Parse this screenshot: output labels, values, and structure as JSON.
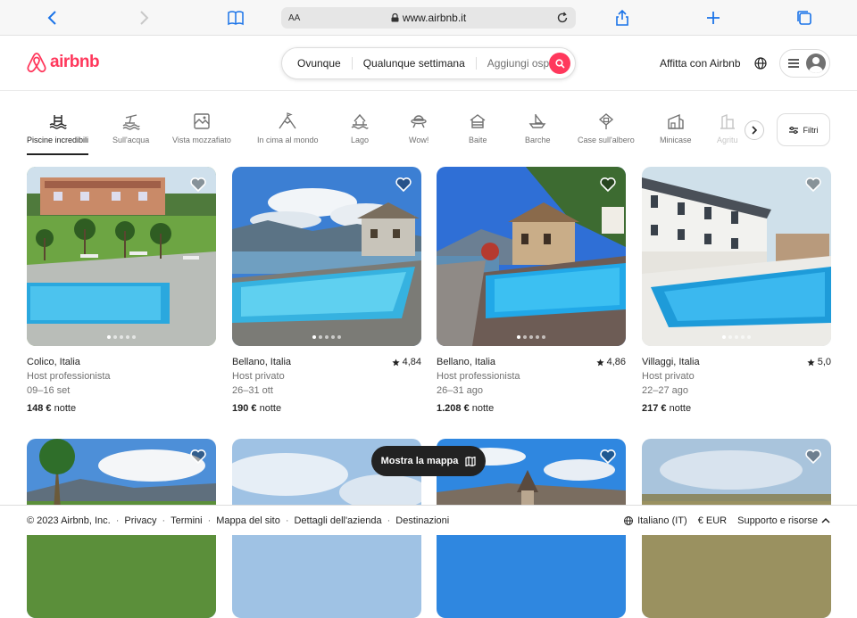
{
  "browser": {
    "aa": "AA",
    "url": "www.airbnb.it"
  },
  "header": {
    "logo": "airbnb",
    "search": {
      "anywhere": "Ovunque",
      "week": "Qualunque settimana",
      "guests": "Aggiungi ospiti"
    },
    "host_link": "Affitta con Airbnb"
  },
  "categories": [
    {
      "label": "Piscine incredibili",
      "icon": "pool-icon"
    },
    {
      "label": "Sull'acqua",
      "icon": "beach-icon"
    },
    {
      "label": "Vista mozzafiato",
      "icon": "view-icon"
    },
    {
      "label": "In cima al mondo",
      "icon": "mountain-icon"
    },
    {
      "label": "Lago",
      "icon": "lake-icon"
    },
    {
      "label": "Wow!",
      "icon": "ufo-icon"
    },
    {
      "label": "Baite",
      "icon": "cabin-icon"
    },
    {
      "label": "Barche",
      "icon": "boat-icon"
    },
    {
      "label": "Case sull'albero",
      "icon": "treehouse-icon"
    },
    {
      "label": "Minicase",
      "icon": "tiny-house-icon"
    },
    {
      "label": "Agritu",
      "icon": "farm-icon"
    }
  ],
  "filters_label": "Filtri",
  "listings": [
    {
      "location": "Colico, Italia",
      "host": "Host professionista",
      "dates": "09–16 set",
      "price": "148 €",
      "unit": "notte",
      "rating": ""
    },
    {
      "location": "Bellano, Italia",
      "host": "Host privato",
      "dates": "26–31 ott",
      "price": "190 €",
      "unit": "notte",
      "rating": "4,84"
    },
    {
      "location": "Bellano, Italia",
      "host": "Host professionista",
      "dates": "26–31 ago",
      "price": "1.208 €",
      "unit": "notte",
      "rating": "4,86"
    },
    {
      "location": "Villaggi, Italia",
      "host": "Host privato",
      "dates": "22–27 ago",
      "price": "217 €",
      "unit": "notte",
      "rating": "5,0"
    }
  ],
  "map_button": "Mostra la mappa",
  "footer": {
    "copyright": "© 2023 Airbnb, Inc.",
    "links": [
      "Privacy",
      "Termini",
      "Mappa del sito",
      "Dettagli dell'azienda",
      "Destinazioni"
    ],
    "language": "Italiano (IT)",
    "currency": "€ EUR",
    "support": "Supporto e risorse"
  }
}
